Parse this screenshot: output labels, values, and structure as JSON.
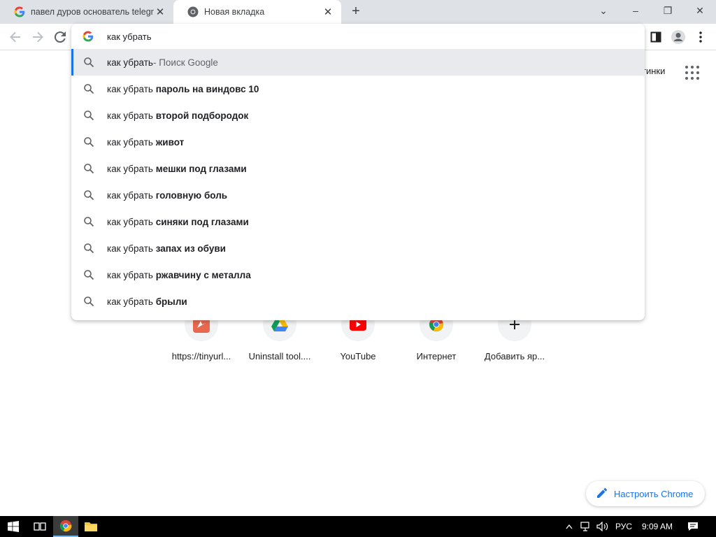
{
  "tabs": [
    {
      "title": "павел дуров основатель telegra",
      "close": "✕",
      "favicon": "google-g-icon"
    },
    {
      "title": "Новая вкладка",
      "close": "✕",
      "favicon": "chrome-icon"
    }
  ],
  "new_tab_label": "+",
  "window_controls": {
    "minimize": "–",
    "restore": "❐",
    "close": "✕",
    "search_tabs": "⌄"
  },
  "omnibox": {
    "value": "как убрать"
  },
  "suggestions": [
    {
      "prefix": "как убрать",
      "bold": "",
      "suffix": " - Поиск Google"
    },
    {
      "prefix": "как убрать ",
      "bold": "пароль на виндовс 10",
      "suffix": ""
    },
    {
      "prefix": "как убрать ",
      "bold": "второй подбородок",
      "suffix": ""
    },
    {
      "prefix": "как убрать ",
      "bold": "живот",
      "suffix": ""
    },
    {
      "prefix": "как убрать ",
      "bold": "мешки под глазами",
      "suffix": ""
    },
    {
      "prefix": "как убрать ",
      "bold": "головную боль",
      "suffix": ""
    },
    {
      "prefix": "как убрать ",
      "bold": "синяки под глазами",
      "suffix": ""
    },
    {
      "prefix": "как убрать ",
      "bold": "запах из обуви",
      "suffix": ""
    },
    {
      "prefix": "как убрать ",
      "bold": "ржавчину с металла",
      "suffix": ""
    },
    {
      "prefix": "как убрать ",
      "bold": "брыли",
      "suffix": ""
    }
  ],
  "page": {
    "images_link_partial": "тинки"
  },
  "shortcuts": [
    {
      "label": "https://tinyurl...",
      "icon": "tinyurl-icon"
    },
    {
      "label": "Uninstall tool....",
      "icon": "google-drive-icon"
    },
    {
      "label": "YouTube",
      "icon": "youtube-icon"
    },
    {
      "label": "Интернет",
      "icon": "chrome-icon"
    },
    {
      "label": "Добавить яр...",
      "icon": "plus-icon"
    }
  ],
  "customize_label": "Настроить Chrome",
  "taskbar": {
    "lang": "РУС",
    "time": "9:09 AM"
  },
  "colors": {
    "accent": "#1a73e8",
    "tabstrip": "#dee1e6",
    "youtube": "#ff0000"
  }
}
